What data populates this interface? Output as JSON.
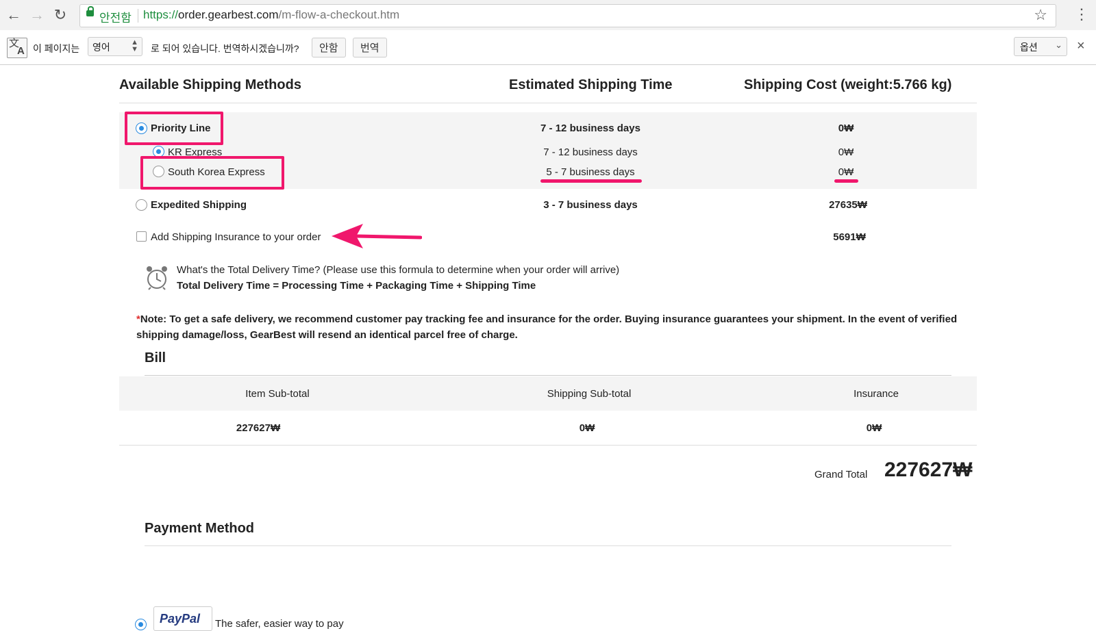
{
  "browser": {
    "secure_label": "안전함",
    "url_scheme": "https://",
    "url_host": "order.gearbest.com",
    "url_path": "/m-flow-a-checkout.htm"
  },
  "translate_bar": {
    "prefix": "이 페이지는",
    "language": "영어",
    "suffix": "로 되어 있습니다. 번역하시겠습니까?",
    "no_button": "안함",
    "translate_button": "번역",
    "options": "옵션"
  },
  "shipping": {
    "col_method": "Available Shipping Methods",
    "col_time": "Estimated Shipping Time",
    "col_cost": "Shipping Cost (weight:5.766 kg)",
    "rows": [
      {
        "label": "Priority Line",
        "time": "7 - 12 business days",
        "cost": "0₩"
      },
      {
        "label": "KR Express",
        "time": "7 - 12 business days",
        "cost": "0₩"
      },
      {
        "label": "South Korea Express",
        "time": "5 - 7 business days",
        "cost": "0₩"
      },
      {
        "label": "Expedited Shipping",
        "time": "3 - 7 business days",
        "cost": "27635₩"
      }
    ],
    "insurance_label": "Add Shipping Insurance to your order",
    "insurance_cost": "5691₩",
    "delivery_question": "What's the Total Delivery Time? (Please use this formula to determine when your order will arrive)",
    "delivery_formula": "Total Delivery Time = Processing Time + Packaging Time + Shipping Time",
    "note_star": "*",
    "note": "Note: To get a safe delivery, we recommend customer pay tracking fee and insurance for the order. Buying insurance guarantees your shipment. In the event of verified shipping damage/loss, GearBest will resend an identical parcel free of charge."
  },
  "bill": {
    "title": "Bill",
    "headers": [
      "Item Sub-total",
      "Shipping Sub-total",
      "Insurance"
    ],
    "values": [
      "227627₩",
      "0₩",
      "0₩"
    ],
    "grand_total_label": "Grand Total",
    "grand_total": "227627₩"
  },
  "payment": {
    "title": "Payment Method",
    "paypal_logo": "PayPal",
    "paypal_text": "The safer, easier way to pay"
  },
  "colors": {
    "annotation": "#f0176c",
    "accent": "#2a8be0",
    "secure": "#1e8e3e"
  }
}
